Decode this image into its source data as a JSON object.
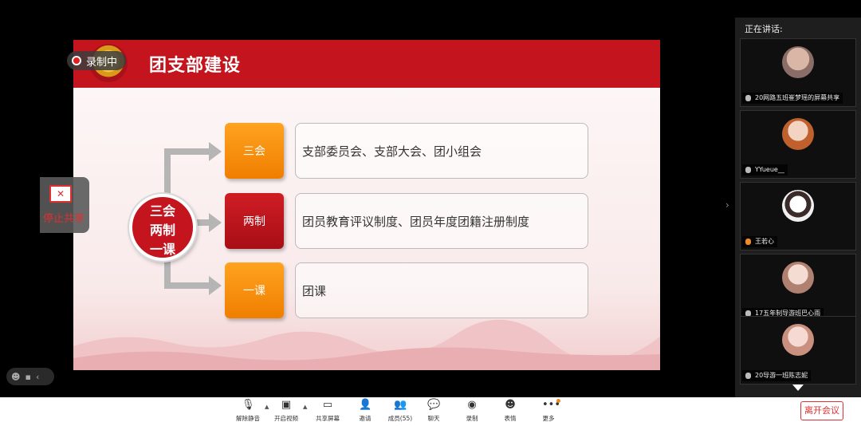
{
  "slide": {
    "title": "团支部建设",
    "center": [
      "三会",
      "两制",
      "一课"
    ],
    "rows": [
      {
        "tag": "三会",
        "text": "支部委员会、支部大会、团小组会",
        "color": "orange"
      },
      {
        "tag": "两制",
        "text": "团员教育评议制度、团员年度团籍注册制度",
        "color": "red"
      },
      {
        "tag": "一课",
        "text": "团课",
        "color": "orange"
      }
    ]
  },
  "recording": {
    "label": "录制中"
  },
  "stop_share": {
    "label": "停止共享"
  },
  "panel": {
    "header": "正在讲话:",
    "participants": [
      {
        "name": "20网路五班崔梦瑶的屏幕共享"
      },
      {
        "name": "YYueue__"
      },
      {
        "name": "王若心"
      },
      {
        "name": "17五年制导游班巴心雨"
      },
      {
        "name": "20导游一班陈志妮"
      }
    ]
  },
  "toolbar": {
    "items": [
      {
        "id": "mute",
        "label": "解除静音",
        "icon": "mic-muted-icon"
      },
      {
        "id": "video",
        "label": "开启视频",
        "icon": "camera-off-icon"
      },
      {
        "id": "share",
        "label": "共享屏幕",
        "icon": "share-screen-icon"
      },
      {
        "id": "invite",
        "label": "邀请",
        "icon": "invite-icon"
      },
      {
        "id": "members",
        "label": "成员(55)",
        "icon": "members-icon"
      },
      {
        "id": "chat",
        "label": "聊天",
        "icon": "chat-icon"
      },
      {
        "id": "record",
        "label": "录制",
        "icon": "record-icon"
      },
      {
        "id": "reaction",
        "label": "表情",
        "icon": "emoji-icon"
      },
      {
        "id": "more",
        "label": "更多",
        "icon": "more-icon"
      }
    ],
    "leave_label": "离开会议"
  },
  "colors": {
    "accent_red": "#c4141e",
    "orange": "#f58a0a",
    "leave_red": "#e03030"
  }
}
